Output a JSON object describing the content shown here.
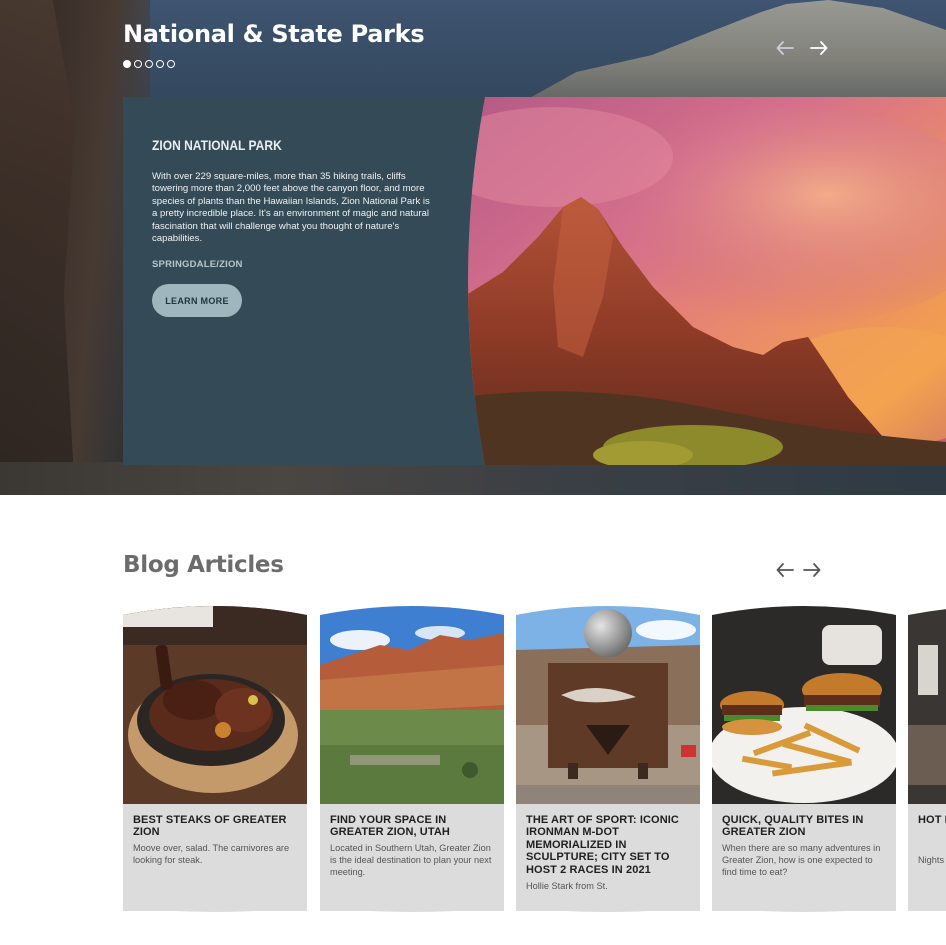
{
  "hero": {
    "title": "National & State Parks",
    "dots": 5,
    "active_dot": 0,
    "card": {
      "name": "ZION NATIONAL PARK",
      "description": "With over 229 square-miles, more than 35 hiking trails, cliffs towering more than 2,000 feet above the canyon floor, and more species of plants than the Hawaiian Islands, Zion National Park is a pretty incredible place. It's an environment of magic and natural fascination that will challenge what you thought of nature's capabilities.",
      "location": "SPRINGDALE/ZION",
      "button": "LEARN MORE"
    }
  },
  "blog": {
    "title": "Blog Articles",
    "articles": [
      {
        "title": "BEST STEAKS OF GREATER ZION",
        "desc": "Moove over, salad. The carnivores are looking for steak."
      },
      {
        "title": "FIND YOUR SPACE IN GREATER ZION, UTAH",
        "desc": "Located in Southern Utah, Greater Zion is the ideal destination to plan your next meeting."
      },
      {
        "title": "THE ART OF SPORT: ICONIC IRONMAN M-DOT MEMORIALIZED IN SCULPTURE; CITY SET TO HOST 2 RACES IN 2021",
        "desc": "Hollie Stark from St."
      },
      {
        "title": "QUICK, QUALITY BITES IN GREATER ZION",
        "desc": "When there are so many adventures in Greater Zion, how is one expected to find time to eat?"
      },
      {
        "title": "HOT FAVO ZION",
        "desc": "Nights Zion le of stea"
      }
    ]
  },
  "icons": {
    "arrow_left": "arrow-left-icon",
    "arrow_right": "arrow-right-icon"
  },
  "colors": {
    "card_bg": "#344a56",
    "button_bg": "#9fb6bd",
    "blog_card_bg": "#dcdcdc",
    "blog_title": "#6c6c6c"
  }
}
